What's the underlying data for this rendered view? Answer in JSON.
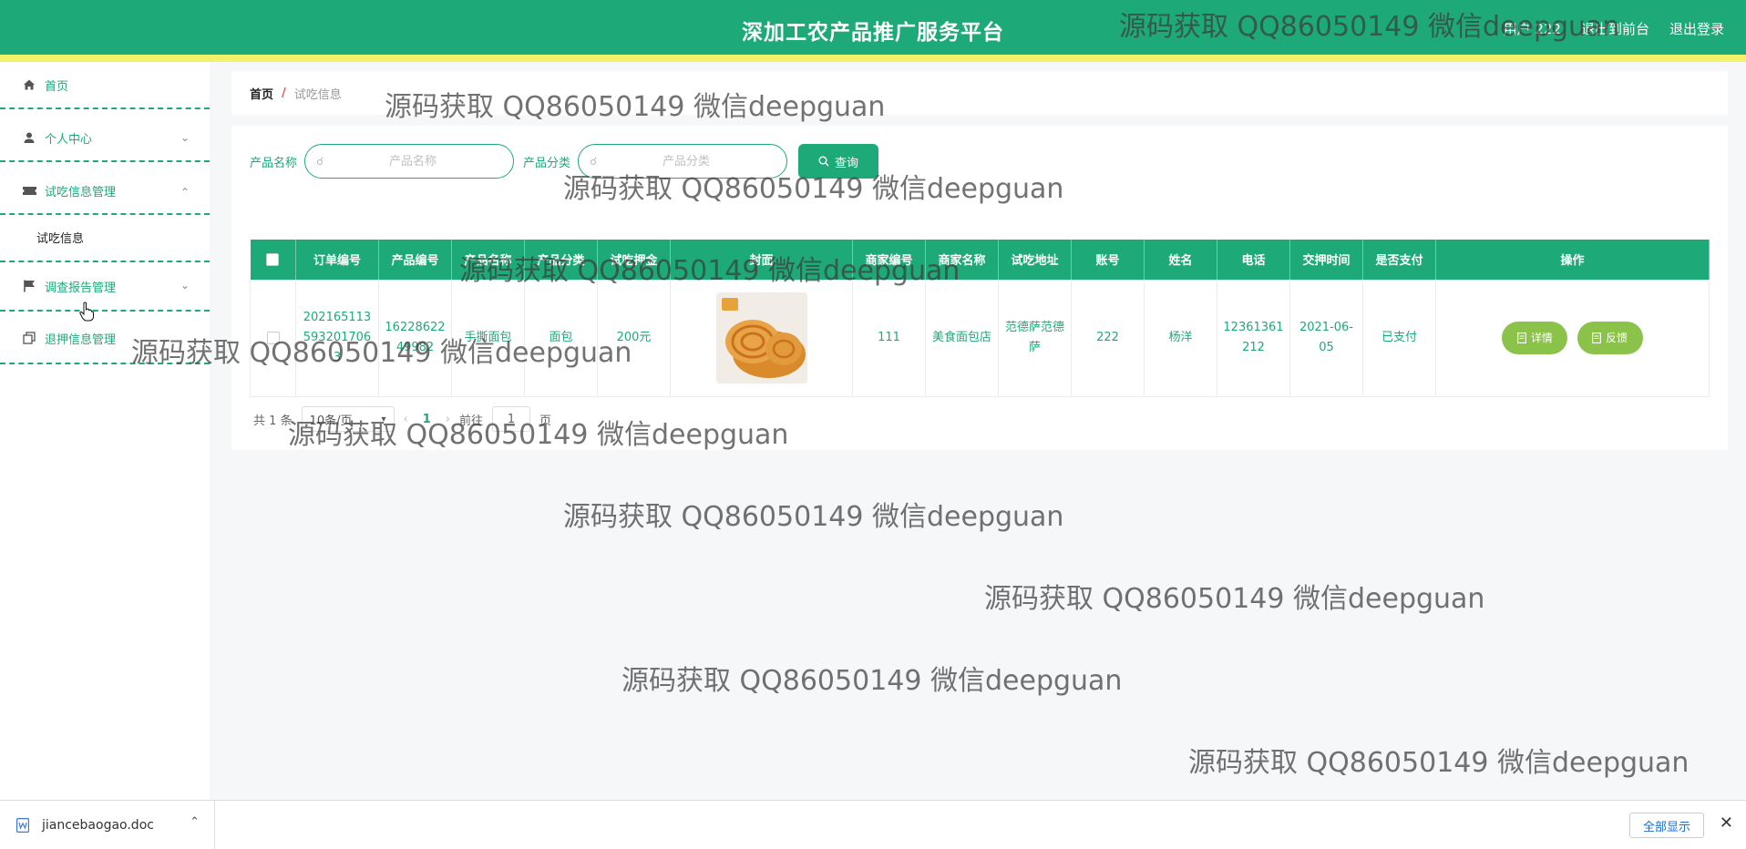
{
  "header": {
    "title": "深加工农产品推广服务平台",
    "user": "用户 222",
    "back_front": "退出到前台",
    "logout": "退出登录"
  },
  "sidebar": {
    "items": [
      {
        "label": "首页",
        "icon": "home-icon"
      },
      {
        "label": "个人中心",
        "icon": "user-icon"
      },
      {
        "label": "试吃信息管理",
        "icon": "ticket-icon"
      },
      {
        "label": "调查报告管理",
        "icon": "flag-icon"
      },
      {
        "label": "退押信息管理",
        "icon": "copy-icon"
      }
    ],
    "submenu": "试吃信息"
  },
  "breadcrumb": {
    "home": "首页",
    "sep": "/",
    "current": "试吃信息"
  },
  "search": {
    "label1": "产品名称",
    "placeholder1": "产品名称",
    "label2": "产品分类",
    "placeholder2": "产品分类",
    "button": "查询"
  },
  "table": {
    "headers": [
      "订单编号",
      "产品编号",
      "产品名称",
      "产品分类",
      "试吃押金",
      "封面",
      "商家编号",
      "商家名称",
      "试吃地址",
      "账号",
      "姓名",
      "电话",
      "交押时间",
      "是否支付",
      "操作"
    ],
    "row": {
      "order_no": "2021651135932017063",
      "product_no": "1622862249982",
      "product_name": "手撕面包",
      "category": "面包",
      "deposit": "200元",
      "merchant_no": "111",
      "merchant_name": "美食面包店",
      "address": "范德萨范德萨",
      "account": "222",
      "name": "杨洋",
      "phone": "12361361212",
      "deposit_time": "2021-06-05",
      "paid": "已支付",
      "btn_detail": "详情",
      "btn_feedback": "反馈"
    }
  },
  "pager": {
    "total": "共 1 条",
    "size": "10条/页",
    "page": "1",
    "goto": "前往",
    "goto_val": "1",
    "unit": "页"
  },
  "watermark": "源码获取 QQ86050149 微信deepguan",
  "download": {
    "file": "jiancebaogao.doc",
    "show_all": "全部显示"
  },
  "colors": {
    "primary": "#1eaa78",
    "stripe": "#f3f16a",
    "action": "#8bc34a",
    "danger": "#e25b4c"
  }
}
